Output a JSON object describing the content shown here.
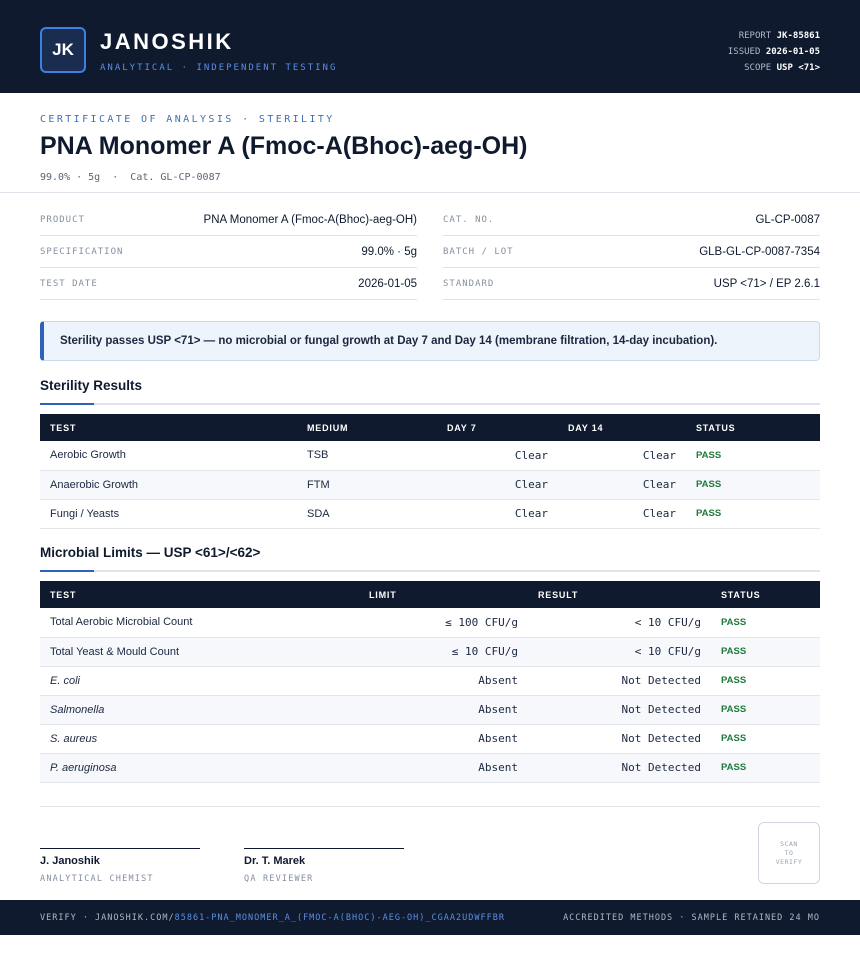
{
  "header": {
    "logo_initials": "JK",
    "brand": "JANOSHIK",
    "brand_sub": "ANALYTICAL · INDEPENDENT TESTING",
    "meta": [
      {
        "label": "REPORT",
        "value": "JK-85861"
      },
      {
        "label": "ISSUED",
        "value": "2026-01-05"
      },
      {
        "label": "SCOPE",
        "value": "USP <71>"
      }
    ]
  },
  "doc": {
    "eyebrow": "CERTIFICATE OF ANALYSIS · STERILITY",
    "title": "PNA Monomer A (Fmoc-A(Bhoc)-aeg-OH)",
    "subtitle": "99.0% · 5g  ·  Cat. GL-CP-0087"
  },
  "info": {
    "left": [
      {
        "label": "PRODUCT",
        "value": "PNA Monomer A (Fmoc-A(Bhoc)-aeg-OH)"
      },
      {
        "label": "SPECIFICATION",
        "value": "99.0% · 5g"
      },
      {
        "label": "TEST DATE",
        "value": "2026-01-05"
      }
    ],
    "right": [
      {
        "label": "CAT. NO.",
        "value": "GL-CP-0087"
      },
      {
        "label": "BATCH / LOT",
        "value": "GLB-GL-CP-0087-7354"
      },
      {
        "label": "STANDARD",
        "value": "USP <71> / EP 2.6.1"
      }
    ]
  },
  "notice": "Sterility passes USP <71> — no microbial or fungal growth at Day 7 and Day 14 (membrane filtration, 14-day incubation).",
  "sterility": {
    "title": "Sterility Results",
    "headers": [
      "TEST",
      "MEDIUM",
      "DAY 7",
      "DAY 14",
      "STATUS"
    ],
    "rows": [
      {
        "test": "Aerobic Growth",
        "medium": "TSB",
        "day7": "Clear",
        "day14": "Clear",
        "status": "PASS"
      },
      {
        "test": "Anaerobic Growth",
        "medium": "FTM",
        "day7": "Clear",
        "day14": "Clear",
        "status": "PASS"
      },
      {
        "test": "Fungi / Yeasts",
        "medium": "SDA",
        "day7": "Clear",
        "day14": "Clear",
        "status": "PASS"
      }
    ]
  },
  "limits": {
    "title": "Microbial Limits — USP <61>/<62>",
    "headers": [
      "TEST",
      "LIMIT",
      "RESULT",
      "STATUS"
    ],
    "rows": [
      {
        "test": "Total Aerobic Microbial Count",
        "limit": "≤ 100 CFU/g",
        "result": "< 10 CFU/g",
        "status": "PASS"
      },
      {
        "test": "Total Yeast & Mould Count",
        "limit": "≤ 10 CFU/g",
        "result": "< 10 CFU/g",
        "status": "PASS"
      },
      {
        "test": "E. coli",
        "limit": "Absent",
        "result": "Not Detected",
        "status": "PASS"
      },
      {
        "test": "Salmonella",
        "limit": "Absent",
        "result": "Not Detected",
        "status": "PASS"
      },
      {
        "test": "S. aureus",
        "limit": "Absent",
        "result": "Not Detected",
        "status": "PASS"
      },
      {
        "test": "P. aeruginosa",
        "limit": "Absent",
        "result": "Not Detected",
        "status": "PASS"
      }
    ]
  },
  "signatures": [
    {
      "name": "J. Janoshik",
      "role": "ANALYTICAL CHEMIST"
    },
    {
      "name": "Dr. T. Marek",
      "role": "QA REVIEWER"
    }
  ],
  "qr": {
    "line1": "SCAN",
    "line2": "TO",
    "line3": "VERIFY"
  },
  "footer": {
    "verify_prefix": "VERIFY · JANOSHIK.COM/",
    "verify_link": "85861-PNA_MONOMER_A_(FMOC-A(BHOC)-AEG-OH)_CGAA2UDWFFBR",
    "right": "ACCREDITED METHODS · SAMPLE RETAINED 24 MO"
  },
  "colors": {
    "navy": "#0f1a2e",
    "accent": "#2c63b8",
    "pass": "#1e7a3a"
  }
}
